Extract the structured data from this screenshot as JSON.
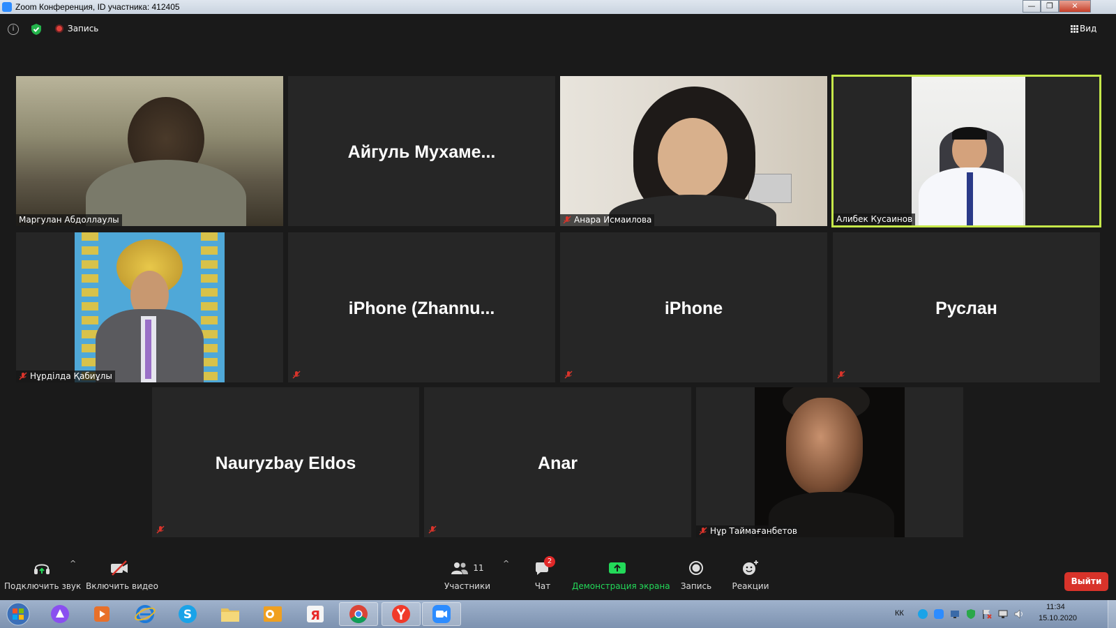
{
  "window": {
    "title": "Zoom Конференция, ID участника: 412405",
    "minimize": "—",
    "maximize": "❐",
    "close": "✕"
  },
  "topbar": {
    "info": "i",
    "record_label": "Запись",
    "view_label": "Вид"
  },
  "tiles": [
    {
      "name": "Маргулан Абдоллаулы",
      "label": "Маргулан Абдоллаулы",
      "muted": false,
      "video": true,
      "active": false
    },
    {
      "name": "Айгуль Мухаме...",
      "label": "",
      "muted": false,
      "video": false,
      "active": false
    },
    {
      "name": "Анара Исмаилова",
      "label": "Анара Исмаилова",
      "muted": true,
      "video": true,
      "active": false
    },
    {
      "name": "Алибек Кусаинов",
      "label": "Алибек Кусаинов",
      "muted": false,
      "video": true,
      "active": true
    },
    {
      "name": "Нұрділда Қабиұлы",
      "label": "Нұрділда Қабиұлы",
      "muted": true,
      "video": true,
      "active": false
    },
    {
      "name": "iPhone (Zhannu...",
      "label": "",
      "muted": true,
      "video": false,
      "active": false
    },
    {
      "name": "iPhone",
      "label": "",
      "muted": true,
      "video": false,
      "active": false
    },
    {
      "name": "Руслан",
      "label": "",
      "muted": true,
      "video": false,
      "active": false
    },
    {
      "name": "Nauryzbay Eldos",
      "label": "",
      "muted": true,
      "video": false,
      "active": false
    },
    {
      "name": "Anar",
      "label": "",
      "muted": true,
      "video": false,
      "active": false
    },
    {
      "name": "Нұр Таймағанбетов",
      "label": "Нұр Таймағанбетов",
      "muted": true,
      "video": true,
      "active": false
    }
  ],
  "toolbar": {
    "audio_label": "Подключить звук",
    "video_label": "Включить видео",
    "participants_label": "Участники",
    "participants_count": "11",
    "chat_label": "Чат",
    "chat_badge": "2",
    "share_label": "Демонстрация экрана",
    "record_label": "Запись",
    "reactions_label": "Реакции",
    "leave_label": "Выйти",
    "caret": "^"
  },
  "taskbar": {
    "lang": "КК",
    "time": "11:34",
    "date": "15.10.2020"
  },
  "colors": {
    "active_border": "#c6e84a",
    "share_green": "#23d959",
    "leave_red": "#d8332a",
    "badge_red": "#e02828",
    "mute_red": "#d9342b"
  }
}
